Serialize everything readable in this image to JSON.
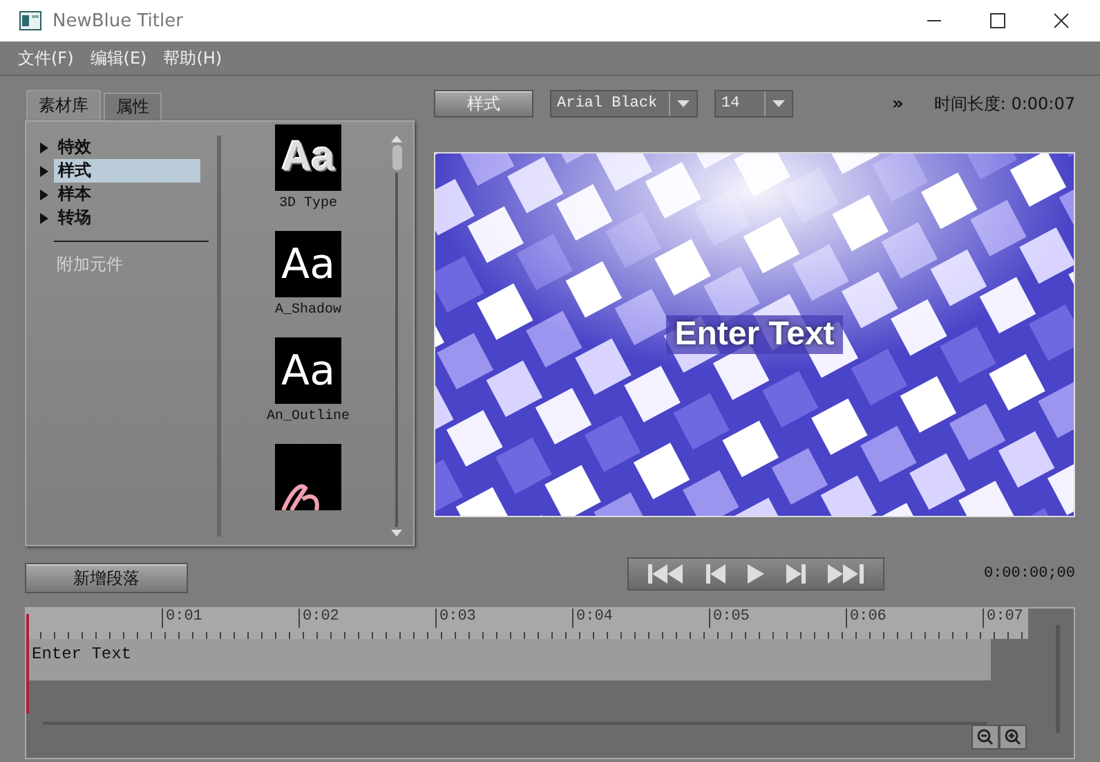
{
  "window": {
    "title": "NewBlue Titler"
  },
  "menu": [
    "文件(F)",
    "编辑(E)",
    "帮助(H)"
  ],
  "tabs": [
    {
      "label": "素材库",
      "selected": true
    },
    {
      "label": "属性",
      "selected": false
    }
  ],
  "tree": [
    {
      "label": "特效",
      "selected": false
    },
    {
      "label": "样式",
      "selected": true
    },
    {
      "label": "样本",
      "selected": false
    },
    {
      "label": "转场",
      "selected": false
    }
  ],
  "addons_label": "附加元件",
  "thumbnails": [
    {
      "kind": "bevel",
      "glyph": "Aa",
      "label": "3D Type"
    },
    {
      "kind": "plain",
      "glyph": "Aa",
      "label": "A_Shadow"
    },
    {
      "kind": "plain",
      "glyph": "Aa",
      "label": "An_Outline"
    },
    {
      "kind": "script"
    }
  ],
  "toolbar": {
    "style_button": "样式",
    "font": "Arial Black",
    "size": "14",
    "more": "»",
    "duration": "时间长度: 0:00:07"
  },
  "preview": {
    "text": "Enter Text"
  },
  "add_paragraph": "新增段落",
  "timecode": "0:00:00;00",
  "timeline": {
    "ticks": [
      "0:01",
      "0:02",
      "0:03",
      "0:04",
      "0:05",
      "0:06",
      "0:07"
    ],
    "clip": "Enter Text"
  }
}
